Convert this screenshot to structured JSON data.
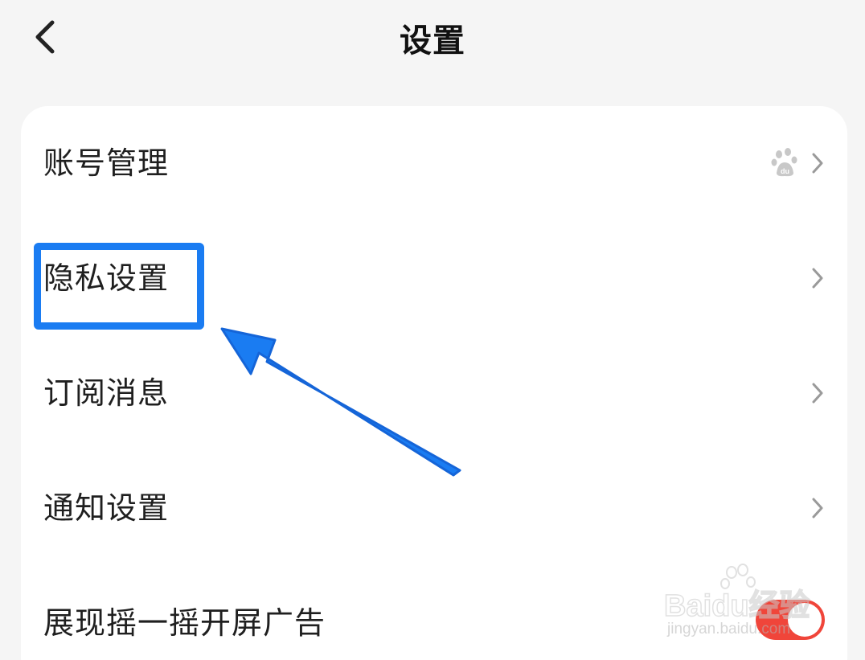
{
  "header": {
    "title": "设置",
    "back_icon": "chevron-left-icon"
  },
  "settings": {
    "items": [
      {
        "label": "账号管理",
        "trailing_icon": "baidu-paw-icon",
        "chevron": "chevron-right-icon"
      },
      {
        "label": "隐私设置",
        "chevron": "chevron-right-icon"
      },
      {
        "label": "订阅消息",
        "chevron": "chevron-right-icon"
      },
      {
        "label": "通知设置",
        "chevron": "chevron-right-icon"
      },
      {
        "label": "展现摇一摇开屏广告",
        "control": "toggle",
        "toggle_on": true
      }
    ]
  },
  "annotation": {
    "highlight_color": "#1a7cf2",
    "arrow_color": "#1a7cf2",
    "highlighted_item": "隐私设置"
  },
  "watermark": {
    "brand": "Baidu经验",
    "url": "jingyan.baidu.com"
  },
  "colors": {
    "background": "#f5f5f5",
    "card": "#ffffff",
    "toggle_on": "#f0453a",
    "chevron": "#9a9a9a"
  }
}
